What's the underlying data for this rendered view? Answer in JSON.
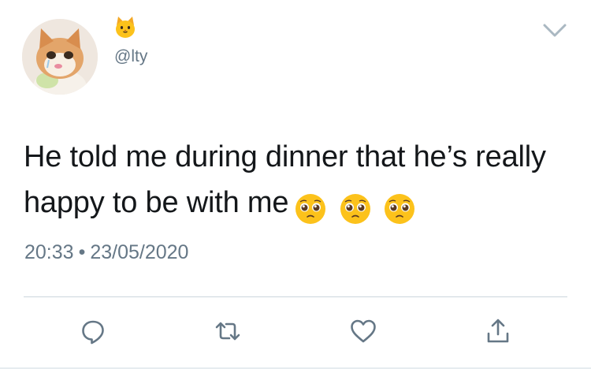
{
  "tweet": {
    "handle": "@lty",
    "text": "He told me during dinner that he’s really happy to be with me",
    "time": "20:33",
    "separator": "•",
    "date": "23/05/2020"
  },
  "icons": {
    "display_name": "cat-face-emoji",
    "avatar": "crying-cat-photo",
    "menu": "chevron-down-icon",
    "text_emojis": [
      "pleading-face-emoji",
      "pleading-face-emoji",
      "pleading-face-emoji"
    ],
    "actions": [
      "reply-icon",
      "retweet-icon",
      "like-icon",
      "share-icon"
    ]
  },
  "colors": {
    "text": "#14171a",
    "secondary": "#657786",
    "icon": "#657786",
    "divider": "#ccd6dd",
    "emoji_yellow": "#fcc21b"
  }
}
